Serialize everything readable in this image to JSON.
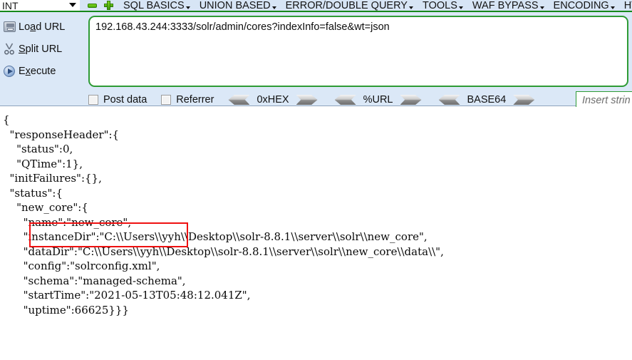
{
  "menubar": {
    "type_selector": {
      "value": "INT",
      "icon": "chevron-down-icon"
    },
    "remove_icon": "minus-icon",
    "add_icon": "plus-icon",
    "items": [
      {
        "label": "SQL BASICS",
        "caret": true
      },
      {
        "label": "UNION BASED",
        "caret": true
      },
      {
        "label": "ERROR/DOUBLE QUERY",
        "caret": true
      },
      {
        "label": "TOOLS",
        "caret": true
      },
      {
        "label": "WAF BYPASS",
        "caret": true
      },
      {
        "label": "ENCODING",
        "caret": true
      },
      {
        "label": "HT",
        "caret": false
      }
    ]
  },
  "actions": [
    {
      "icon": "load-url-icon",
      "label_pre": "Lo",
      "label_accel": "a",
      "label_post": "d URL",
      "name": "load-url-button"
    },
    {
      "icon": "scissors-icon",
      "label_pre": "",
      "label_accel": "S",
      "label_post": "plit URL",
      "name": "split-url-button"
    },
    {
      "icon": "play-icon",
      "label_pre": "E",
      "label_accel": "x",
      "label_post": "ecute",
      "name": "execute-button"
    }
  ],
  "url_input": {
    "value": "192.168.43.244:3333/solr/admin/cores?indexInfo=false&wt=json",
    "border_color": "#2e9b35"
  },
  "options": {
    "checkboxes": [
      {
        "label": "Post data",
        "checked": false
      },
      {
        "label": "Referrer",
        "checked": false
      }
    ],
    "converters": [
      {
        "label": "0xHEX"
      },
      {
        "label": "%URL"
      },
      {
        "label": "BASE64"
      }
    ],
    "insert_string": {
      "placeholder": "Insert strin",
      "value": ""
    }
  },
  "response": {
    "body": "{\n  \"responseHeader\":{\n    \"status\":0,\n    \"QTime\":1},\n  \"initFailures\":{},\n  \"status\":{\n    \"new_core\":{\n      \"name\":\"new_core\",\n      \"instanceDir\":\"C:\\\\Users\\\\yyh\\\\Desktop\\\\solr-8.8.1\\\\server\\\\solr\\\\new_core\",\n      \"dataDir\":\"C:\\\\Users\\\\yyh\\\\Desktop\\\\solr-8.8.1\\\\server\\\\solr\\\\new_core\\\\data\\\\\",\n      \"config\":\"solrconfig.xml\",\n      \"schema\":\"managed-schema\",\n      \"startTime\":\"2021-05-13T05:48:12.041Z\",\n      \"uptime\":66625}}}"
  },
  "annotation": {
    "highlight_color": "#ef1010",
    "target_text": "\"name\":\"new_core\","
  }
}
